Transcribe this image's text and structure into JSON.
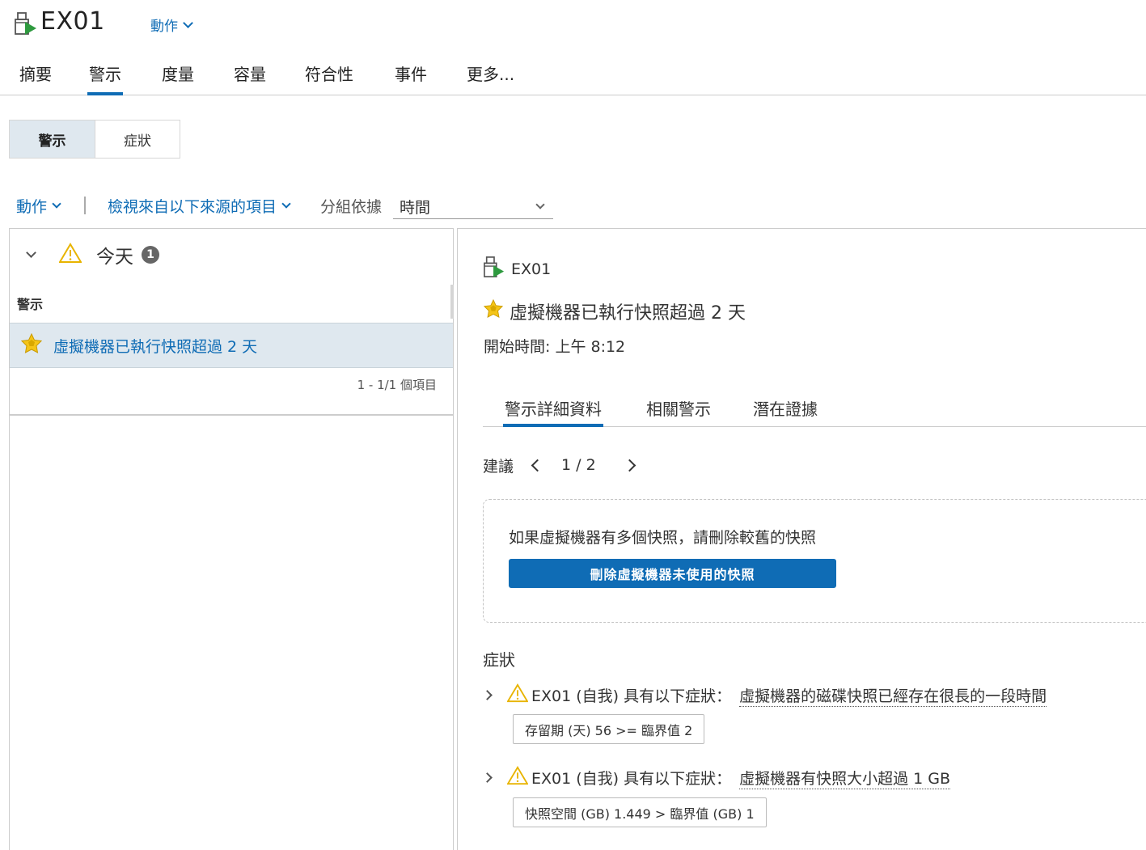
{
  "header": {
    "title": "EX01",
    "actions_label": "動作"
  },
  "main_tabs": [
    {
      "label": "摘要"
    },
    {
      "label": "警示"
    },
    {
      "label": "度量"
    },
    {
      "label": "容量"
    },
    {
      "label": "符合性"
    },
    {
      "label": "事件"
    },
    {
      "label": "更多..."
    }
  ],
  "segment": {
    "alerts": "警示",
    "symptoms": "症狀"
  },
  "toolbar": {
    "actions": "動作",
    "view_from": "檢視來自以下來源的項目",
    "group_by_label": "分組依據",
    "group_by_value": "時間"
  },
  "list": {
    "group_label": "今天",
    "group_count": "1",
    "column_header": "警示",
    "items": [
      {
        "label": "虛擬機器已執行快照超過 2 天"
      }
    ],
    "pager": "1 - 1/1 個項目"
  },
  "detail": {
    "vm_name": "EX01",
    "alert_title": "虛擬機器已執行快照超過 2 天",
    "start_time": "開始時間: 上午 8:12",
    "tabs": [
      {
        "label": "警示詳細資料"
      },
      {
        "label": "相關警示"
      },
      {
        "label": "潛在證據"
      }
    ],
    "recommendation_label": "建議",
    "recommendation_page": "1 / 2",
    "recommendation_text": "如果虛擬機器有多個快照，請刪除較舊的快照",
    "recommendation_button": "刪除虛擬機器未使用的快照",
    "symptoms_label": "症狀",
    "symptoms": [
      {
        "prefix": "EX01 (自我) 具有以下症狀：",
        "link": "虛擬機器的磁碟快照已經存在很長的一段時間",
        "chip": "存留期 (天) 56 >= 臨界值 2"
      },
      {
        "prefix": "EX01 (自我) 具有以下症狀：",
        "link": "虛擬機器有快照大小超過 1 GB",
        "chip": "快照空間 (GB) 1.449 > 臨界值 (GB) 1"
      }
    ]
  },
  "colors": {
    "accent": "#0f6cb5",
    "selected_bg": "#dfe8ef",
    "warning": "#f5c518",
    "vm_icon_green": "#2e9a3f"
  },
  "icons": {
    "vm": "vm-icon",
    "warning": "warning-triangle-icon",
    "star": "alert-star-icon"
  }
}
